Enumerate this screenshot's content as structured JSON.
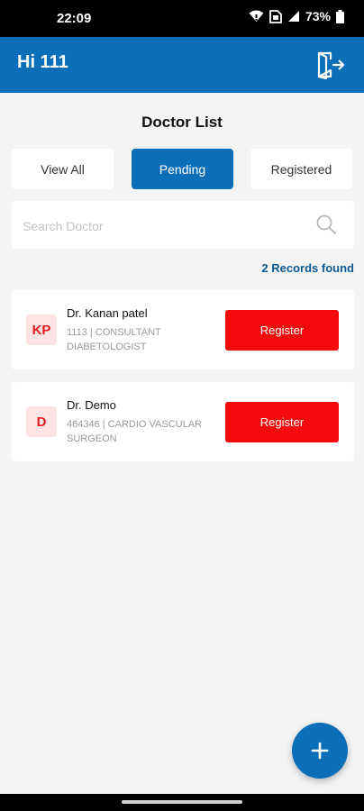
{
  "status_bar": {
    "time": "22:09",
    "battery": "73%",
    "icons": [
      "wifi-icon",
      "sim-icon",
      "signal-icon",
      "battery-icon"
    ]
  },
  "header": {
    "greeting": "Hi 111",
    "logout_icon": "logout-icon",
    "background": "#0a6eb9"
  },
  "page": {
    "title": "Doctor List"
  },
  "tabs": [
    {
      "label": "View All",
      "active": false
    },
    {
      "label": "Pending",
      "active": true
    },
    {
      "label": "Registered",
      "active": false
    }
  ],
  "search": {
    "placeholder": "Search Doctor",
    "value": ""
  },
  "records": {
    "count_text": "2 Records found"
  },
  "doctors": [
    {
      "initials": "KP",
      "name": "Dr. Kanan patel",
      "detail": "1113 | consultant diabetologist",
      "action": "Register"
    },
    {
      "initials": "D",
      "name": "Dr. Demo",
      "detail": "464346 | cardio vascular surgeon",
      "action": "Register"
    }
  ],
  "fab": {
    "icon": "plus-icon"
  },
  "colors": {
    "primary": "#0a6eb9",
    "danger": "#f40a0a",
    "avatar_bg": "#fde3e3",
    "avatar_text": "#e11d1d"
  }
}
